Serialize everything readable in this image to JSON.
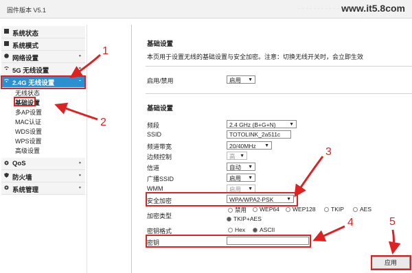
{
  "topbar": {
    "firmware": "固件版本 V5.1",
    "watermark": "www.it5⁠.8com"
  },
  "sidebar": {
    "items": [
      {
        "label": "系统状态",
        "icon": "square-icon"
      },
      {
        "label": "系统模式",
        "icon": "square-icon"
      },
      {
        "label": "网络设置",
        "icon": "globe-icon"
      },
      {
        "label": "5G 无线设置",
        "icon": "wifi-icon"
      },
      {
        "label": "2.4G 无线设置",
        "icon": "wifi-icon"
      },
      {
        "label": "QoS",
        "icon": "gear-icon"
      },
      {
        "label": "防火墙",
        "icon": "shield-icon"
      },
      {
        "label": "系统管理",
        "icon": "gear-icon"
      }
    ],
    "sub_items": [
      "无线状态",
      "基础设置",
      "多AP设置",
      "MAC认证",
      "WDS设置",
      "WPS设置",
      "高级设置"
    ]
  },
  "main": {
    "title": "基础设置",
    "description": "本页用于设置无线的基础设置与安全加密。注意：切换无线开关时，会立即生效",
    "enable_label": "启用/禁用",
    "enable_value": "启用",
    "section_title": "基础设置",
    "fields": {
      "band": {
        "label": "频段",
        "value": "2.4 GHz (B+G+N)"
      },
      "ssid": {
        "label": "SSID",
        "value": "TOTOLINK_2a511c"
      },
      "bandwidth": {
        "label": "频道带宽",
        "value": "20/40MHz"
      },
      "sideband": {
        "label": "边频控制",
        "value": "高"
      },
      "channel": {
        "label": "信道",
        "value": "自动"
      },
      "broadcast": {
        "label": "广播SSID",
        "value": "启用"
      },
      "wmm": {
        "label": "WMM",
        "value": "启用"
      },
      "security": {
        "label": "安全加密",
        "value": "WPA/WPA2-PSK"
      },
      "encryption": {
        "label": "加密类型",
        "options": [
          "禁用",
          "WEP64",
          "WEP128",
          "TKIP",
          "AES",
          "TKIP+AES"
        ]
      },
      "key_format": {
        "label": "密钥格式",
        "options": [
          "Hex",
          "ASCII"
        ]
      },
      "key": {
        "label": "密钥",
        "value": ""
      }
    },
    "apply_label": "应用"
  },
  "annotations": [
    "1",
    "2",
    "3",
    "4",
    "5"
  ],
  "colors": {
    "annotation": "#dd2222",
    "active_menu": "#2b8fd0"
  }
}
